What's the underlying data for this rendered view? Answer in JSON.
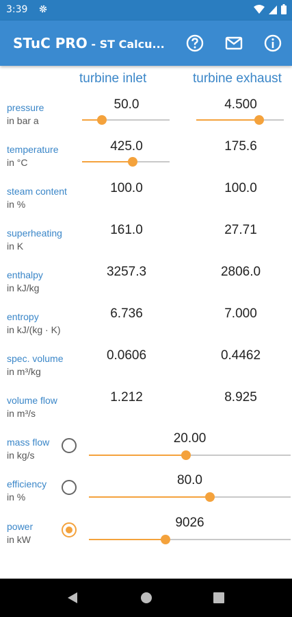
{
  "status": {
    "time": "3:39"
  },
  "app": {
    "title": "STuC PRO",
    "subtitle": " - ST Calcu...",
    "help_icon": "help-circle-icon",
    "mail_icon": "mail-icon",
    "info_icon": "info-icon"
  },
  "columns": {
    "inlet": "turbine inlet",
    "exhaust": "turbine exhaust"
  },
  "rows": {
    "pressure": {
      "label": "pressure",
      "unit": "in bar a",
      "inlet": "50.0",
      "exhaust": "4.500",
      "inlet_slider": 0.23,
      "exhaust_slider": 0.72
    },
    "temperature": {
      "label": "temperature",
      "unit": "in °C",
      "inlet": "425.0",
      "exhaust": "175.6",
      "inlet_slider": 0.58
    },
    "steam_content": {
      "label": "steam content",
      "unit": "in %",
      "inlet": "100.0",
      "exhaust": "100.0"
    },
    "superheating": {
      "label": "superheating",
      "unit": "in K",
      "inlet": "161.0",
      "exhaust": "27.71"
    },
    "enthalpy": {
      "label": "enthalpy",
      "unit": "in kJ/kg",
      "inlet": "3257.3",
      "exhaust": "2806.0"
    },
    "entropy": {
      "label": "entropy",
      "unit": "in kJ/(kg · K)",
      "inlet": "6.736",
      "exhaust": "7.000"
    },
    "spec_volume": {
      "label": "spec. volume",
      "unit": "in m³/kg",
      "inlet": "0.0606",
      "exhaust": "0.4462"
    },
    "volume_flow": {
      "label": "volume flow",
      "unit": "in m³/s",
      "inlet": "1.212",
      "exhaust": "8.925"
    },
    "mass_flow": {
      "label": "mass flow",
      "unit": "in kg/s",
      "value": "20.00",
      "slider": 0.48,
      "selected": false
    },
    "efficiency": {
      "label": "efficiency",
      "unit": "in %",
      "value": "80.0",
      "slider": 0.6,
      "selected": false
    },
    "power": {
      "label": "power",
      "unit": "in kW",
      "value": "9026",
      "slider": 0.38,
      "selected": true
    }
  },
  "colors": {
    "appbar": "#3a8ad0",
    "statusbar": "#2a7dc0",
    "accent": "#f4a23c",
    "label": "#3a86c8"
  }
}
